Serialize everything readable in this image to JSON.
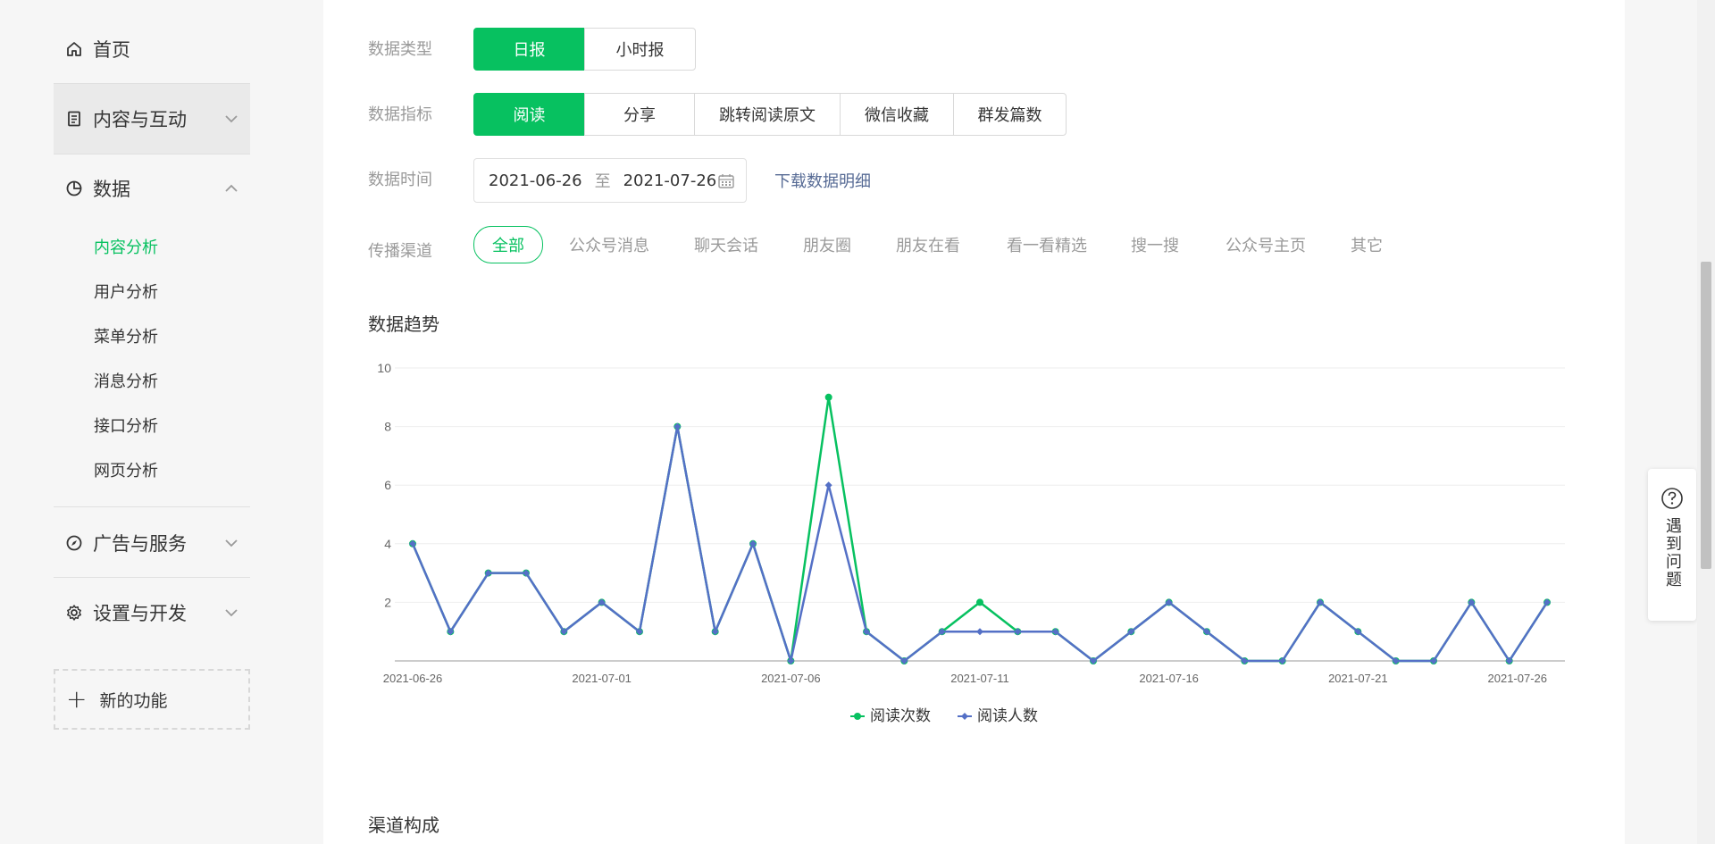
{
  "sidebar": {
    "home": "首页",
    "content": "内容与互动",
    "data": "数据",
    "sub_items": [
      "内容分析",
      "用户分析",
      "菜单分析",
      "消息分析",
      "接口分析",
      "网页分析"
    ],
    "ads": "广告与服务",
    "settings": "设置与开发",
    "new_feature": "新的功能"
  },
  "filters": {
    "type_label": "数据类型",
    "type_options": [
      "日报",
      "小时报"
    ],
    "metric_label": "数据指标",
    "metric_options": [
      "阅读",
      "分享",
      "跳转阅读原文",
      "微信收藏",
      "群发篇数"
    ],
    "time_label": "数据时间",
    "date_start": "2021-06-26",
    "date_sep": "至",
    "date_end": "2021-07-26",
    "download": "下载数据明细",
    "channel_label": "传播渠道",
    "channels": [
      "全部",
      "公众号消息",
      "聊天会话",
      "朋友圈",
      "朋友在看",
      "看一看精选",
      "搜一搜",
      "公众号主页",
      "其它"
    ]
  },
  "trend_title": "数据趋势",
  "channel_title": "渠道构成",
  "help": "遇到问题",
  "colors": {
    "accent": "#07c160",
    "blue": "#5470c6",
    "link": "#576b95"
  },
  "chart_data": {
    "type": "line",
    "title": "",
    "xlabel": "",
    "ylabel": "",
    "ylim": [
      0,
      10
    ],
    "yticks": [
      2,
      4,
      6,
      8,
      10
    ],
    "grid": true,
    "legend_position": "bottom-center",
    "x": [
      "2021-06-26",
      "2021-06-27",
      "2021-06-28",
      "2021-06-29",
      "2021-06-30",
      "2021-07-01",
      "2021-07-02",
      "2021-07-03",
      "2021-07-04",
      "2021-07-05",
      "2021-07-06",
      "2021-07-07",
      "2021-07-08",
      "2021-07-09",
      "2021-07-10",
      "2021-07-11",
      "2021-07-12",
      "2021-07-13",
      "2021-07-14",
      "2021-07-15",
      "2021-07-16",
      "2021-07-17",
      "2021-07-18",
      "2021-07-19",
      "2021-07-20",
      "2021-07-21",
      "2021-07-22",
      "2021-07-23",
      "2021-07-24",
      "2021-07-25",
      "2021-07-26"
    ],
    "x_tick_labels": [
      "2021-06-26",
      "2021-07-01",
      "2021-07-06",
      "2021-07-11",
      "2021-07-16",
      "2021-07-21",
      "2021-07-26"
    ],
    "series": [
      {
        "name": "阅读次数",
        "color": "#07c160",
        "values": [
          4,
          1,
          3,
          3,
          1,
          2,
          1,
          8,
          1,
          4,
          0,
          9,
          1,
          0,
          1,
          2,
          1,
          1,
          0,
          1,
          2,
          1,
          0,
          0,
          2,
          1,
          0,
          0,
          2,
          0,
          2
        ]
      },
      {
        "name": "阅读人数",
        "color": "#5470c6",
        "values": [
          4,
          1,
          3,
          3,
          1,
          2,
          1,
          8,
          1,
          4,
          0,
          6,
          1,
          0,
          1,
          1,
          1,
          1,
          0,
          1,
          2,
          1,
          0,
          0,
          2,
          1,
          0,
          0,
          2,
          0,
          2
        ]
      }
    ]
  }
}
